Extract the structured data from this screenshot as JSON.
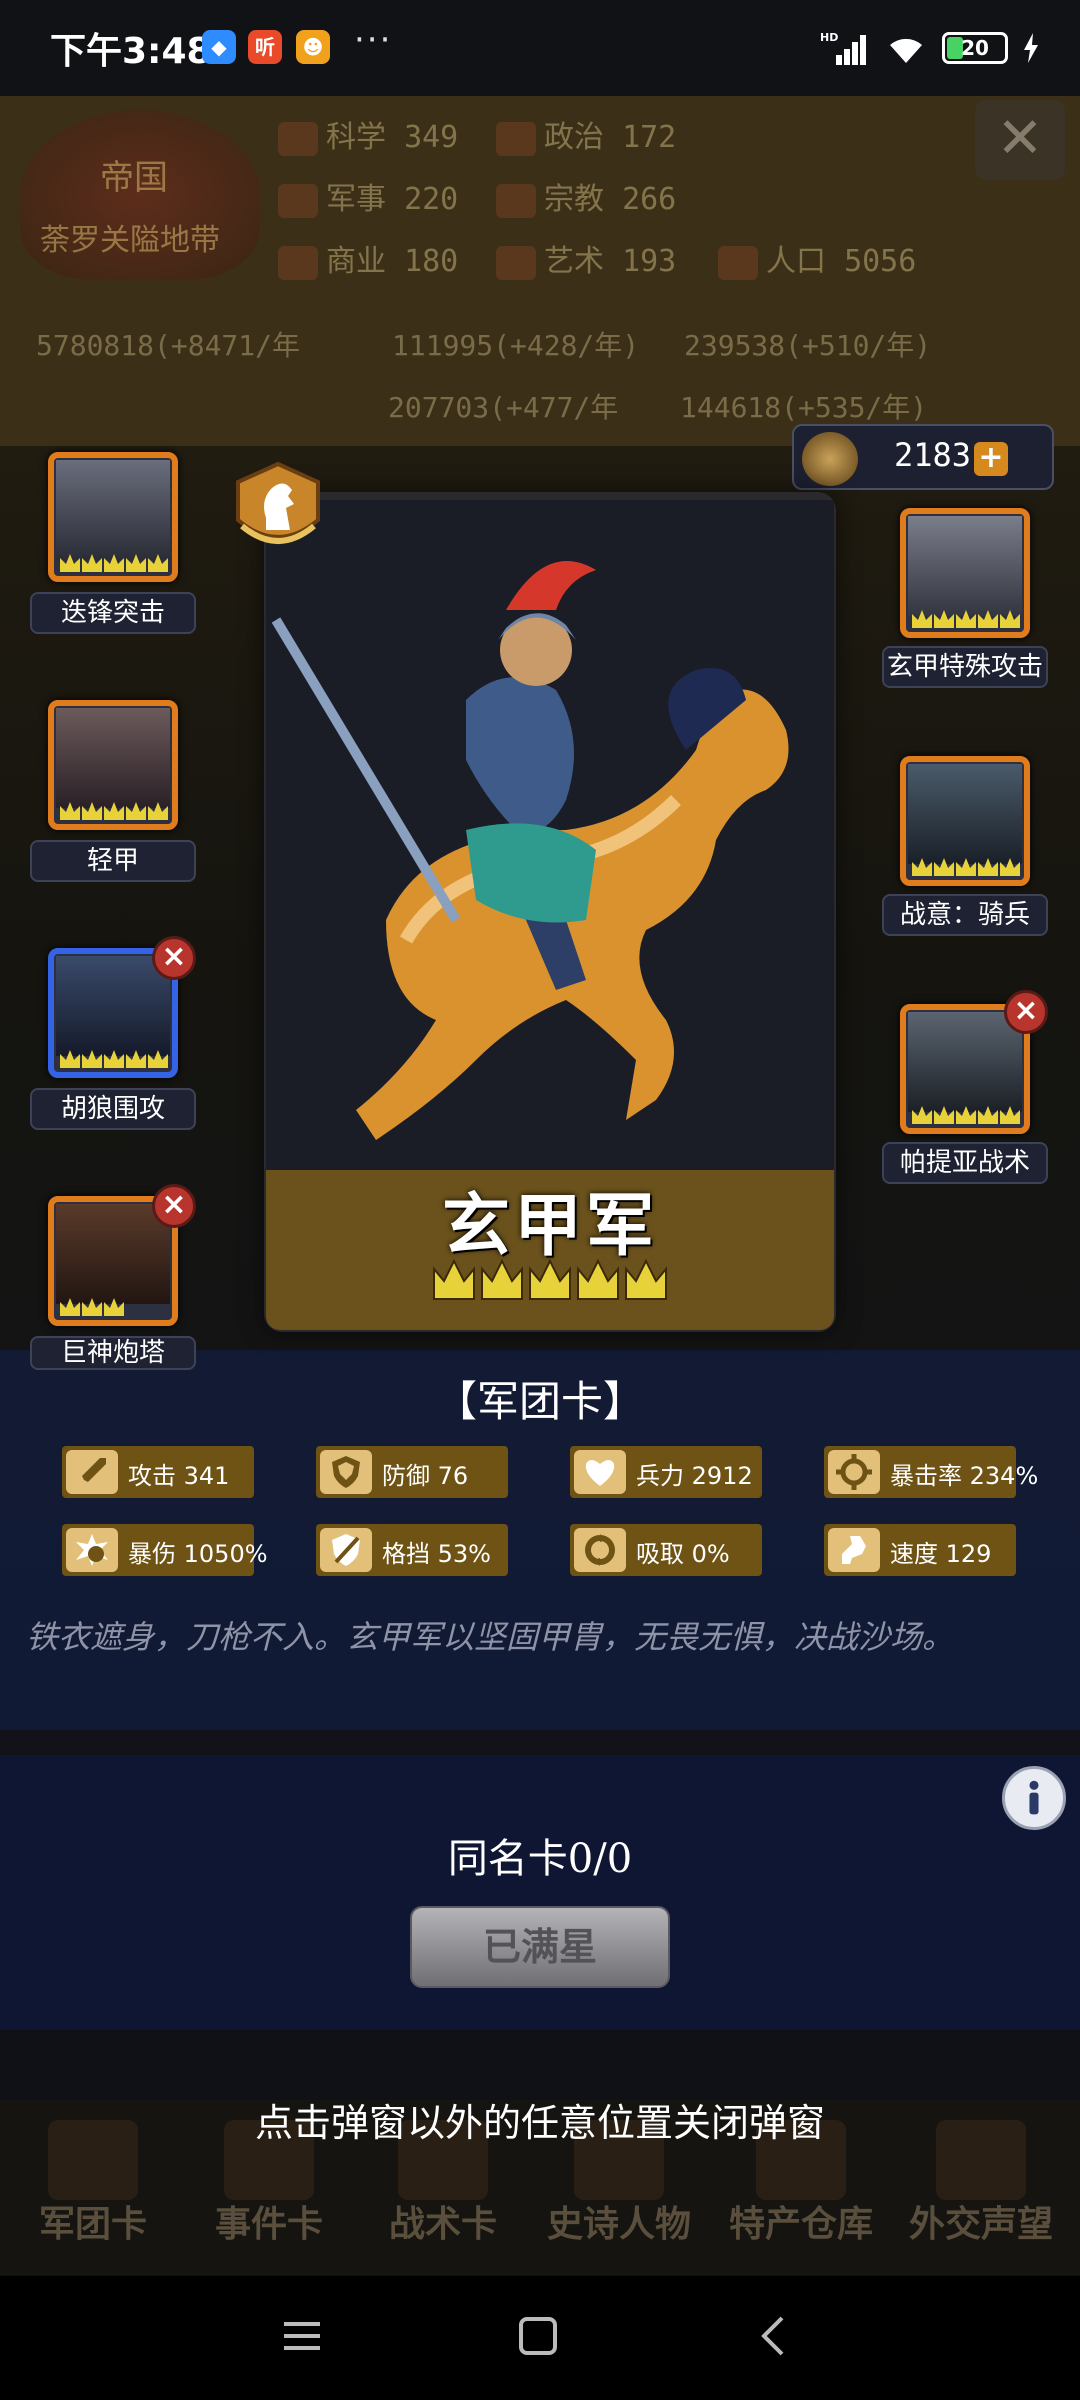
{
  "status_bar": {
    "time": "下午3:48",
    "app_icons": [
      {
        "name": "app-icon-blue",
        "color": "#2f8cff",
        "glyph": ""
      },
      {
        "name": "app-icon-ting",
        "color": "#e84a2a",
        "glyph": "听"
      },
      {
        "name": "app-icon-yellow",
        "color": "#f2a11c",
        "glyph": ""
      }
    ],
    "more": "···",
    "network": "HD",
    "battery": "20"
  },
  "background": {
    "empire_title": "帝国",
    "empire_name": "荼罗关隘地带",
    "stats": [
      {
        "label": "科学",
        "value": "349"
      },
      {
        "label": "政治",
        "value": "172"
      },
      {
        "label": "军事",
        "value": "220"
      },
      {
        "label": "宗教",
        "value": "266"
      },
      {
        "label": "商业",
        "value": "180"
      },
      {
        "label": "艺术",
        "value": "193"
      },
      {
        "label": "人口",
        "value": "5056"
      }
    ],
    "resources": [
      "5780818(+8471/年",
      "111995(+428/年)",
      "239538(+510/年)",
      "207703(+477/年",
      "144618(+535/年)"
    ],
    "bottom_tabs": [
      "军团卡",
      "事件卡",
      "战术卡",
      "史诗人物",
      "特产仓库",
      "外交声望"
    ]
  },
  "currency": {
    "amount": "2183",
    "plus": "+"
  },
  "card": {
    "name": "玄甲军",
    "type_label": "【军团卡】",
    "stars": 5,
    "stats": [
      {
        "icon": "sword-icon",
        "label": "攻击",
        "value": "341"
      },
      {
        "icon": "shield-icon",
        "label": "防御",
        "value": "76"
      },
      {
        "icon": "heart-icon",
        "label": "兵力",
        "value": "2912"
      },
      {
        "icon": "crosshair-icon",
        "label": "暴击率",
        "value": "234%"
      },
      {
        "icon": "burst-icon",
        "label": "暴伤",
        "value": "1050%"
      },
      {
        "icon": "block-icon",
        "label": "格挡",
        "value": "53%"
      },
      {
        "icon": "drain-icon",
        "label": "吸取",
        "value": "0%"
      },
      {
        "icon": "speed-icon",
        "label": "速度",
        "value": "129"
      }
    ],
    "description": "铁衣遮身，刀枪不入。玄甲军以坚固甲胄，无畏无惧，决战沙场。"
  },
  "left_skills": [
    {
      "label": "迭锋突击",
      "frame": "orange",
      "removable": false
    },
    {
      "label": "轻甲",
      "frame": "orange",
      "removable": false
    },
    {
      "label": "胡狼围攻",
      "frame": "blue",
      "removable": true
    },
    {
      "label": "巨神炮塔",
      "frame": "orange",
      "removable": true
    }
  ],
  "right_skills": [
    {
      "label": "玄甲特殊攻击",
      "frame": "orange",
      "removable": false
    },
    {
      "label": "战意：骑兵",
      "frame": "orange",
      "removable": false
    },
    {
      "label": "帕提亚战术",
      "frame": "orange",
      "removable": true
    }
  ],
  "duplicates": {
    "label": "同名卡0/0"
  },
  "upgrade_button": {
    "label": "已满星"
  },
  "hint": "点击弹窗以外的任意位置关闭弹窗",
  "colors": {
    "frame_orange": "#e07c1c",
    "frame_blue": "#3563e6",
    "stat_bg": "#6e5314",
    "modal_bg": "#121a36"
  }
}
